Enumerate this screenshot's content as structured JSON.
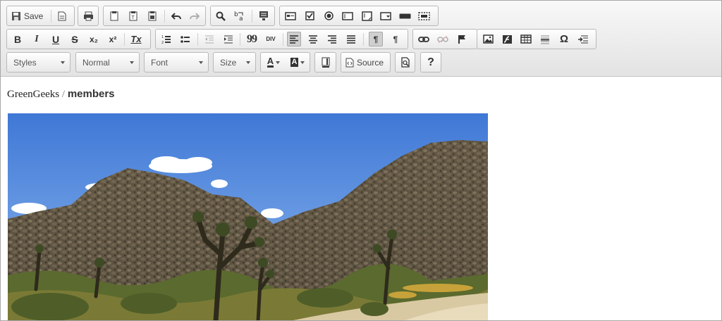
{
  "toolbar": {
    "save_label": "Save",
    "source_label": "Source",
    "help_label": "?",
    "bold_label": "B",
    "italic_label": "I",
    "underline_label": "U",
    "strike_label": "S",
    "subscript_label": "x₂",
    "superscript_label": "x²",
    "remove_format_label": "Tx",
    "blockquote_label": "99",
    "div_label": "DIV",
    "special_char_label": "Ω",
    "ltr_label": "¶",
    "rtl_label": "¶",
    "text_color_label": "A",
    "bg_color_label": "A"
  },
  "combos": {
    "styles": "Styles",
    "format": "Normal",
    "font": "Font",
    "size": "Size"
  },
  "content": {
    "breadcrumb_site": "GreenGeeks",
    "breadcrumb_sep": "/",
    "breadcrumb_page": "members"
  },
  "icons": [
    "save-icon",
    "new-page-icon",
    "print-icon",
    "paste-icon",
    "paste-text-icon",
    "paste-word-icon",
    "undo-icon",
    "redo-icon",
    "find-icon",
    "replace-icon",
    "select-all-icon",
    "form-icon",
    "checkbox-icon",
    "radio-icon",
    "text-field-icon",
    "textarea-icon",
    "select-field-icon",
    "button-icon",
    "image-button-icon",
    "hidden-field-icon",
    "numbered-list-icon",
    "bulleted-list-icon",
    "outdent-icon",
    "indent-icon",
    "align-left-icon",
    "align-center-icon",
    "align-right-icon",
    "justify-icon",
    "link-icon",
    "unlink-icon",
    "anchor-icon",
    "image-icon",
    "flash-icon",
    "table-icon",
    "horizontal-line-icon",
    "page-break-icon",
    "show-blocks-icon",
    "source-icon",
    "preview-icon"
  ]
}
